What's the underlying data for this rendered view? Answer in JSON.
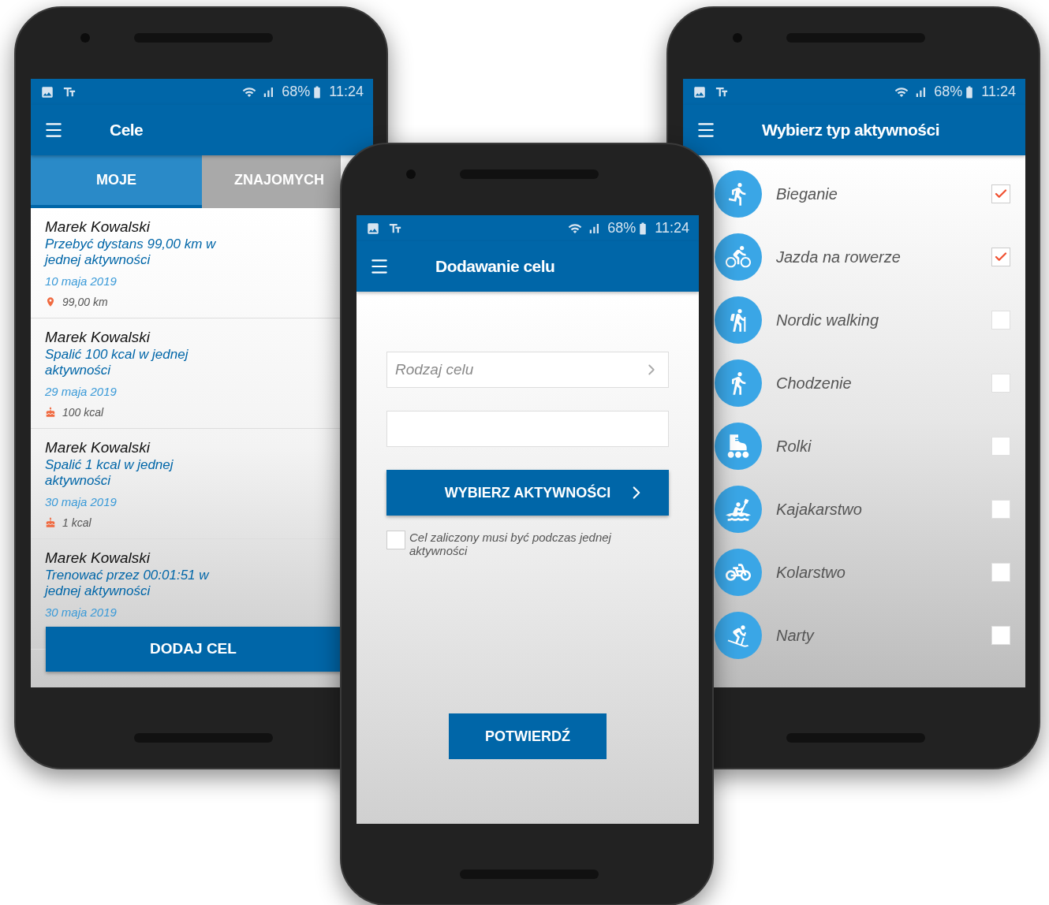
{
  "goals_screen": {
    "status_bar": {
      "battery": "68%",
      "time": "11:24"
    },
    "title": "Cele",
    "tabs": [
      {
        "label": "MOJE",
        "selected": true
      },
      {
        "label": "ZNAJOMYCH",
        "selected": false
      }
    ],
    "goals": [
      {
        "owner": "Marek Kowalski",
        "description": "Przebyć dystans 99,00 km w jednej aktywności",
        "date": "10 maja 2019",
        "amount": "99,00 km",
        "kind": "distance"
      },
      {
        "owner": "Marek Kowalski",
        "description": "Spalić 100 kcal w jednej aktywności",
        "date": "29 maja 2019",
        "amount": "100 kcal",
        "kind": "calories"
      },
      {
        "owner": "Marek Kowalski",
        "description": "Spalić 1 kcal w jednej aktywności",
        "date": "30 maja 2019",
        "amount": "1 kcal",
        "kind": "calories"
      },
      {
        "owner": "Marek Kowalski",
        "description": "Trenować przez 00:01:51 w jednej aktywności",
        "date": "30 maja 2019",
        "kind": "time"
      }
    ],
    "add_button": "DODAJ CEL"
  },
  "add_goal_screen": {
    "status_bar": {
      "battery": "68%",
      "time": "11:24"
    },
    "title": "Dodawanie celu",
    "goal_type_field": {
      "placeholder": "Rodzaj celu"
    },
    "choose_button": "WYBIERZ AKTYWNOŚCI",
    "single_activity": {
      "label": "Cel zaliczony musi być podczas jednej aktywności",
      "checked": false
    },
    "confirm_button": "POTWIERDŹ"
  },
  "activity_screen": {
    "status_bar": {
      "battery": "68%",
      "time": "11:24"
    },
    "title": "Wybierz typ aktywności",
    "activities": [
      {
        "label": "Bieganie",
        "kind": "running",
        "checked": true
      },
      {
        "label": "Jazda na rowerze",
        "kind": "cycling",
        "checked": true
      },
      {
        "label": "Nordic walking",
        "kind": "nordic",
        "checked": false
      },
      {
        "label": "Chodzenie",
        "kind": "walking",
        "checked": false
      },
      {
        "label": "Rolki",
        "kind": "skating",
        "checked": false
      },
      {
        "label": "Kajakarstwo",
        "kind": "kayak",
        "checked": false
      },
      {
        "label": "Kolarstwo",
        "kind": "road_bike",
        "checked": false
      },
      {
        "label": "Narty",
        "kind": "ski",
        "checked": false
      }
    ]
  }
}
